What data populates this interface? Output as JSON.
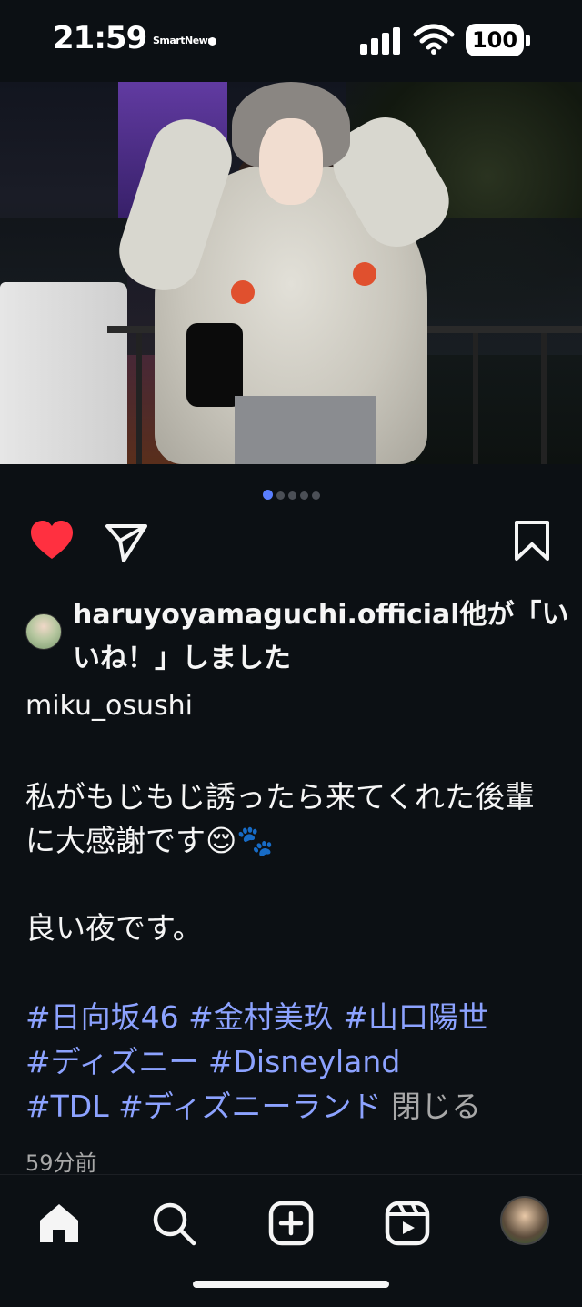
{
  "status_bar": {
    "time": "21:59",
    "app_label": "SmartNews",
    "battery": "100"
  },
  "carousel": {
    "total": 5,
    "active_index": 0
  },
  "post": {
    "liked": true,
    "liked_by_text": "haruyoyamaguchi.official他が「いいね！」しました",
    "username": "miku_osushi",
    "caption_paragraphs": [
      "私がもじもじ誘ったら来てくれた後輩に大感謝です😌🐾",
      "良い夜です。"
    ],
    "hashtags": [
      "#日向坂46",
      "#金村美玖",
      "#山口陽世",
      "#ディズニー",
      "#Disneyland",
      "#TDL",
      "#ディズニーランド"
    ],
    "close_label": "閉じる",
    "timestamp": "59分前"
  },
  "colors": {
    "background": "#0c1014",
    "heart": "#ff3040",
    "hashtag": "#8ca2ff",
    "muted": "#a8a8a8",
    "dot_active": "#5a7fff"
  },
  "icons": {
    "like": "heart-icon",
    "share": "send-icon",
    "save": "bookmark-icon",
    "nav": [
      "home-icon",
      "search-icon",
      "create-icon",
      "reels-icon",
      "profile-avatar"
    ]
  }
}
